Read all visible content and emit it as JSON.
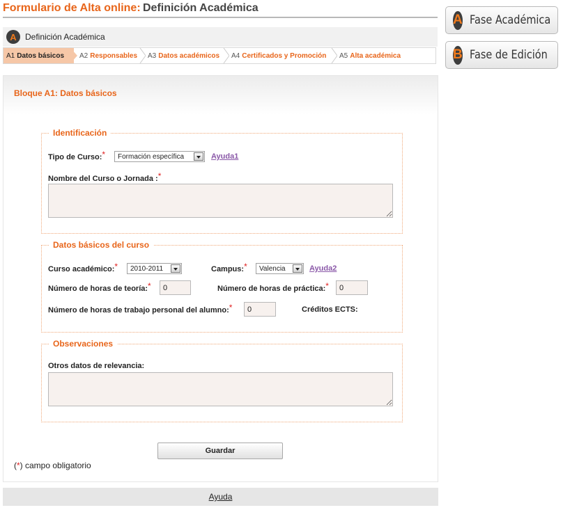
{
  "header": {
    "title_prefix": "Formulario de Alta online:",
    "title_main": "Definición Académica"
  },
  "phases": [
    {
      "letter": "A",
      "label": "Fase Académica"
    },
    {
      "letter": "B",
      "label": "Fase de Edición"
    }
  ],
  "section": {
    "letter": "A",
    "label": "Definición Académica"
  },
  "steps": [
    {
      "num": "A1",
      "label": "Datos básicos"
    },
    {
      "num": "A2",
      "label": "Responsables"
    },
    {
      "num": "A3",
      "label": "Datos académicos"
    },
    {
      "num": "A4",
      "label": "Certificados y Promoción"
    },
    {
      "num": "A5",
      "label": "Alta académica"
    }
  ],
  "block_title": "Bloque A1: Datos básicos",
  "identificacion": {
    "legend": "Identificación",
    "tipo_label": "Tipo de Curso:",
    "tipo_value": "Formación específica",
    "ayuda1": "Ayuda1",
    "nombre_label": "Nombre del Curso o Jornada :",
    "nombre_value": ""
  },
  "datos_basicos": {
    "legend": "Datos básicos del curso",
    "curso_label": "Curso académico:",
    "curso_value": "2010-2011",
    "campus_label": "Campus:",
    "campus_value": "Valencia",
    "ayuda2": "Ayuda2",
    "teoria_label": "Número de horas de teoría:",
    "teoria_value": "0",
    "practica_label": "Número de horas de práctica:",
    "practica_value": "0",
    "personal_label": "Número de horas de trabajo personal del alumno:",
    "personal_value": "0",
    "creditos_label": "Créditos ECTS:"
  },
  "observaciones": {
    "legend": "Observaciones",
    "otros_label": "Otros datos de relevancia:",
    "otros_value": ""
  },
  "required_mark": "*",
  "save_label": "Guardar",
  "oblig": {
    "open": "(",
    "star": "*",
    "text": ") campo obligatorio"
  },
  "footer": {
    "help": "Ayuda"
  }
}
